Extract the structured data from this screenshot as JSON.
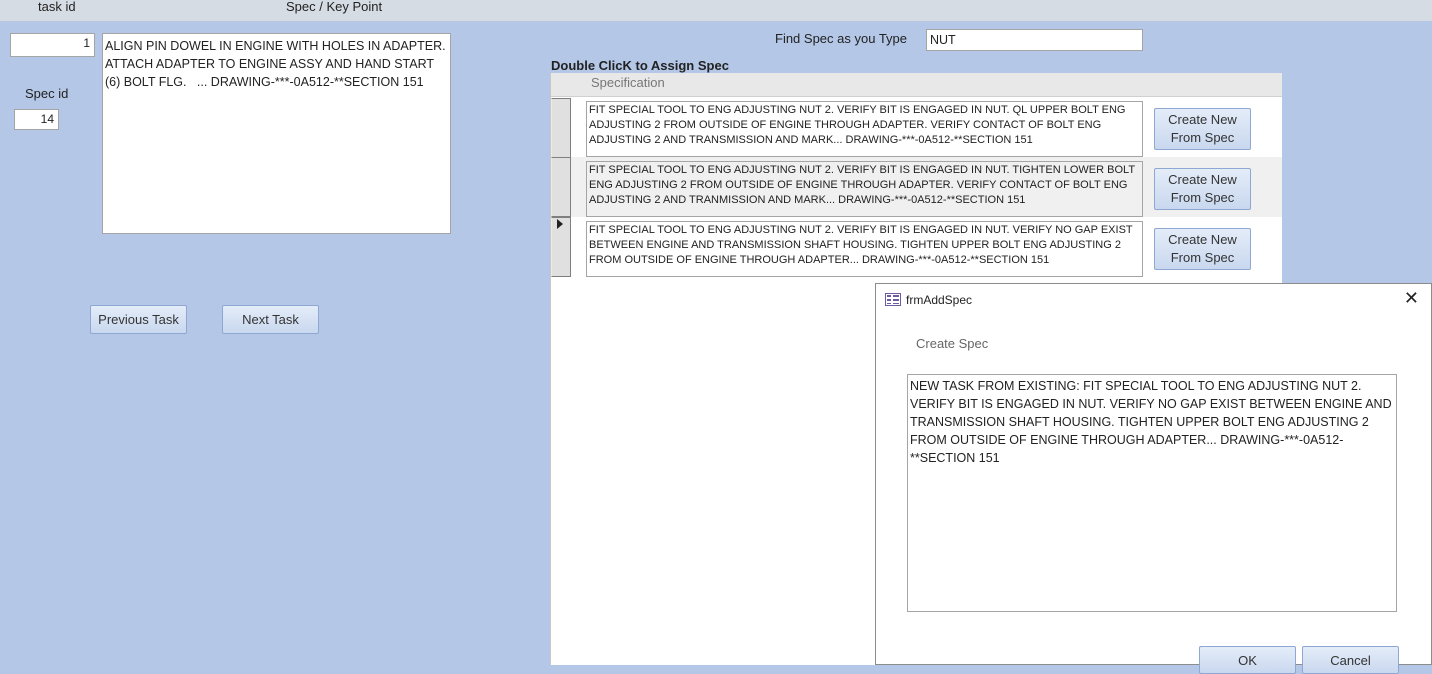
{
  "header": {
    "task_id_label": "task id",
    "spec_key_point_label": "Spec / Key Point"
  },
  "task": {
    "task_id_value": "1",
    "spec_id_label": "Spec id",
    "spec_id_value": "14",
    "key_point_text": "ALIGN PIN DOWEL IN ENGINE WITH HOLES IN ADAPTER. ATTACH ADAPTER TO ENGINE ASSY AND HAND START (6) BOLT FLG.   ... DRAWING-***-0A512-**SECTION 151"
  },
  "nav": {
    "previous_label": "Previous Task",
    "next_label": "Next Task"
  },
  "search": {
    "label": "Find Spec as you Type",
    "value": "NUT"
  },
  "assign_label": "Double ClicK to Assign Spec",
  "spec_list": {
    "column_header": "Specification",
    "create_button_label": "Create New From Spec",
    "rows": [
      {
        "text": "FIT SPECIAL TOOL TO ENG ADJUSTING NUT 2. VERIFY BIT IS ENGAGED IN NUT. QL UPPER BOLT ENG ADJUSTING 2 FROM OUTSIDE OF ENGINE THROUGH ADAPTER. VERIFY CONTACT OF BOLT ENG ADJUSTING 2 AND TRANSMISSION AND MARK... DRAWING-***-0A512-**SECTION 151"
      },
      {
        "text": "FIT SPECIAL TOOL TO ENG ADJUSTING NUT 2. VERIFY BIT IS ENGAGED IN NUT. TIGHTEN LOWER BOLT ENG ADJUSTING 2 FROM OUTSIDE OF ENGINE THROUGH ADAPTER. VERIFY CONTACT OF BOLT ENG ADJUSTING 2 AND TRANMISSION AND MARK... DRAWING-***-0A512-**SECTION 151"
      },
      {
        "text": "FIT SPECIAL TOOL TO ENG ADJUSTING NUT 2. VERIFY BIT IS ENGAGED IN NUT. VERIFY NO GAP EXIST BETWEEN ENGINE AND TRANSMISSION SHAFT HOUSING. TIGHTEN UPPER BOLT ENG ADJUSTING 2 FROM OUTSIDE OF ENGINE THROUGH ADAPTER... DRAWING-***-0A512-**SECTION 151",
        "current": true
      }
    ]
  },
  "dialog": {
    "title": "frmAddSpec",
    "close_symbol": "✕",
    "heading": "Create Spec",
    "text": "NEW TASK FROM EXISTING: FIT SPECIAL TOOL TO ENG ADJUSTING NUT 2. VERIFY BIT IS ENGAGED IN NUT. VERIFY NO GAP EXIST BETWEEN ENGINE AND TRANSMISSION SHAFT HOUSING. TIGHTEN UPPER BOLT ENG ADJUSTING 2 FROM OUTSIDE OF ENGINE THROUGH ADAPTER... DRAWING-***-0A512-**SECTION 151",
    "ok_label": "OK",
    "cancel_label": "Cancel"
  }
}
